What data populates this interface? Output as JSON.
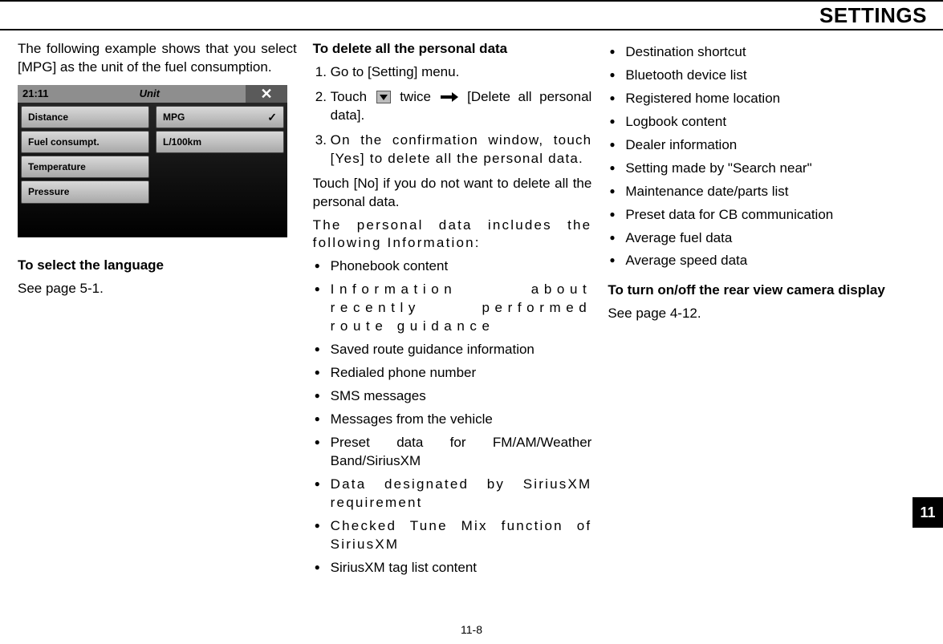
{
  "header": {
    "title": "SETTINGS"
  },
  "col1": {
    "intro": "The following example shows that you select [MPG] as the unit of the fuel consumption.",
    "screenshot": {
      "time": "21:11",
      "title": "Unit",
      "close": "✕",
      "left": [
        "Distance",
        "Fuel consumpt.",
        "Temperature",
        "Pressure"
      ],
      "right": [
        "MPG",
        "L/100km"
      ]
    },
    "lang_heading": "To select the language",
    "lang_ref": "See page 5-1."
  },
  "col2": {
    "heading": "To delete all the personal data",
    "step1": "Go to [Setting] menu.",
    "step2_a": "Touch",
    "step2_b": "twice",
    "step2_c": "[Delete all personal data].",
    "step3": "On the confirmation window, touch [Yes] to delete all the personal data.",
    "step3_sub": "Touch [No] if you do not want to delete all the personal data.",
    "includes_intro": "The personal data includes the following Information:",
    "bullets": [
      "Phonebook content",
      "Information about recently performed route guidance",
      "Saved route guidance information",
      "Redialed phone number",
      "SMS messages",
      "Messages from the vehicle",
      "Preset data for FM/AM/Weather Band/SiriusXM",
      "Data designated by SiriusXM requirement",
      "Checked Tune Mix function of SiriusXM",
      "SiriusXM tag list content"
    ]
  },
  "col3": {
    "bullets": [
      "Destination shortcut",
      "Bluetooth device list",
      "Registered home location",
      "Logbook content",
      "Dealer information",
      "Setting made by \"Search near\"",
      "Maintenance date/parts list",
      "Preset data for CB communication",
      "Average fuel data",
      "Average speed data"
    ],
    "camera_heading": "To turn on/off the rear view camera display",
    "camera_ref": "See page 4-12."
  },
  "footer": {
    "page": "11-8",
    "tab": "11"
  }
}
